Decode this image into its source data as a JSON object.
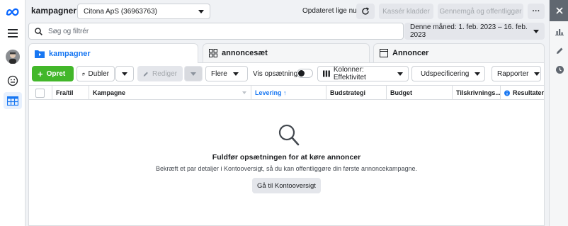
{
  "app": {
    "title": "kampagner",
    "account": "Citona ApS (36963763)",
    "updated_text": "Opdateret lige nu",
    "discard_label": "Kassér kladder",
    "review_label": "Gennemgå og offentliggør",
    "more_label": "···"
  },
  "search": {
    "placeholder": "Søg og filtrér"
  },
  "daterange": {
    "label": "Denne måned: 1. feb. 2023 – 16. feb. 2023"
  },
  "tabs": [
    {
      "label": "kampagner",
      "icon": "folder-icon",
      "active": true
    },
    {
      "label": "annoncesæt",
      "icon": "grid-icon",
      "active": false
    },
    {
      "label": "Annoncer",
      "icon": "window-icon",
      "active": false
    }
  ],
  "toolbar": {
    "create_label": "Opret",
    "duplicate_label": "Dubler",
    "edit_label": "Rediger",
    "more_label": "Flere",
    "view_setup_label": "Vis opsætning",
    "columns_label": "Kolonner: Effektivitet",
    "breakdown_label": "Udspecificering",
    "reports_label": "Rapporter"
  },
  "table": {
    "columns": [
      "Fra/til",
      "Kampagne",
      "Levering ↑",
      "Budstrategi",
      "Budget",
      "Tilskrivnings...",
      "Resultater"
    ]
  },
  "empty_state": {
    "title": "Fuldfør opsætningen for at køre annoncer",
    "description": "Bekræft et par detaljer i Kontooversigt, så du kan offentliggøre din første annoncekampagne.",
    "button_label": "Gå til Kontooversigt"
  },
  "colors": {
    "accent": "#1877f2",
    "create_green": "#42b72a"
  }
}
